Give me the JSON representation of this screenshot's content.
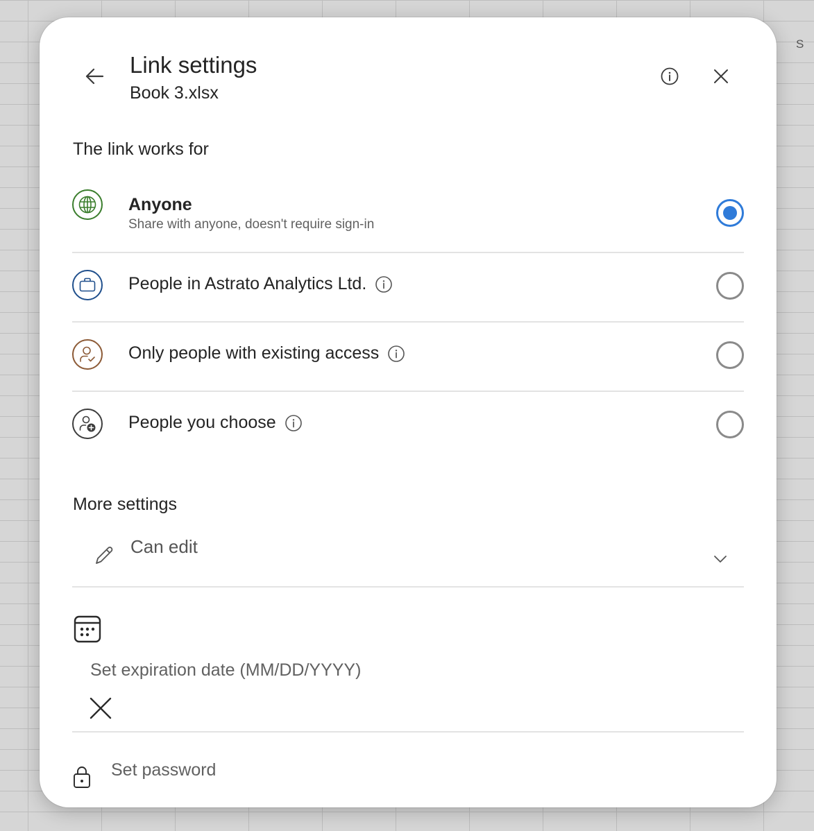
{
  "background": {
    "column_label": "S"
  },
  "dialog": {
    "title": "Link settings",
    "subtitle": "Book 3.xlsx",
    "back_icon": "arrow-left-icon",
    "info_icon": "info-icon",
    "close_icon": "close-icon"
  },
  "link_works_for": {
    "heading": "The link works for",
    "options": [
      {
        "label": "Anyone",
        "description": "Share with anyone, doesn't require sign-in",
        "icon": "globe-icon",
        "icon_color": "#3a7d2c",
        "selected": true
      },
      {
        "label": "People in Astrato Analytics Ltd.",
        "icon": "briefcase-icon",
        "icon_color": "#1f4f8c",
        "selected": false
      },
      {
        "label": "Only people with existing access",
        "icon": "person-check-icon",
        "icon_color": "#8c5a36",
        "selected": false
      },
      {
        "label": "People you choose",
        "icon": "person-add-icon",
        "icon_color": "#3d3d3d",
        "selected": false
      }
    ]
  },
  "more_settings": {
    "heading": "More settings",
    "permission": {
      "value": "Can edit",
      "icon": "pencil-icon"
    },
    "expiration": {
      "icon": "calendar-icon",
      "placeholder": "Set expiration date (MM/DD/YYYY)",
      "clear_icon": "close-icon"
    },
    "password": {
      "icon": "lock-icon",
      "placeholder": "Set password"
    }
  },
  "colors": {
    "accent": "#2f7bd9",
    "text": "#242424",
    "muted_text": "#616161",
    "divider": "#e3e3e3"
  }
}
